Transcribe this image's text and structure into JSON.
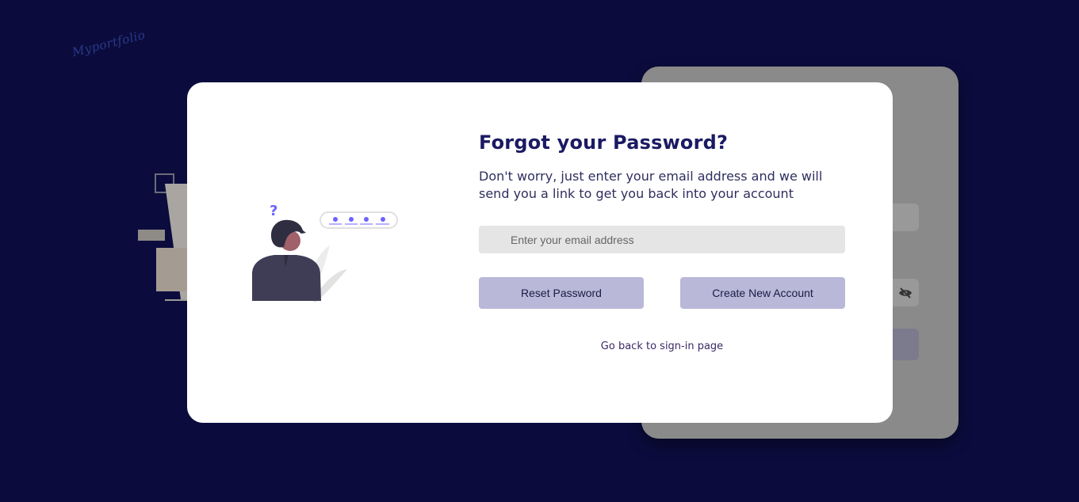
{
  "brand": {
    "logo_text": "Myportfolio"
  },
  "background_card": {
    "password_visibility_icon": "eye-slash-icon"
  },
  "modal": {
    "title": "Forgot your Password?",
    "description": "Don't worry, just enter your email address and we will send you a link to get you back into your account",
    "email": {
      "value": "",
      "placeholder": "Enter your email address"
    },
    "reset_button": "Reset Password",
    "create_account_button": "Create New Account",
    "back_link": "Go back to sign-in page",
    "illustration": "person-forgot-password-illustration"
  },
  "colors": {
    "page_background": "#0b0c3d",
    "modal_background": "#ffffff",
    "title": "#1b1a63",
    "button": "#b9b8d8",
    "input_background": "#e5e5e5",
    "accent": "#6c63ff"
  }
}
